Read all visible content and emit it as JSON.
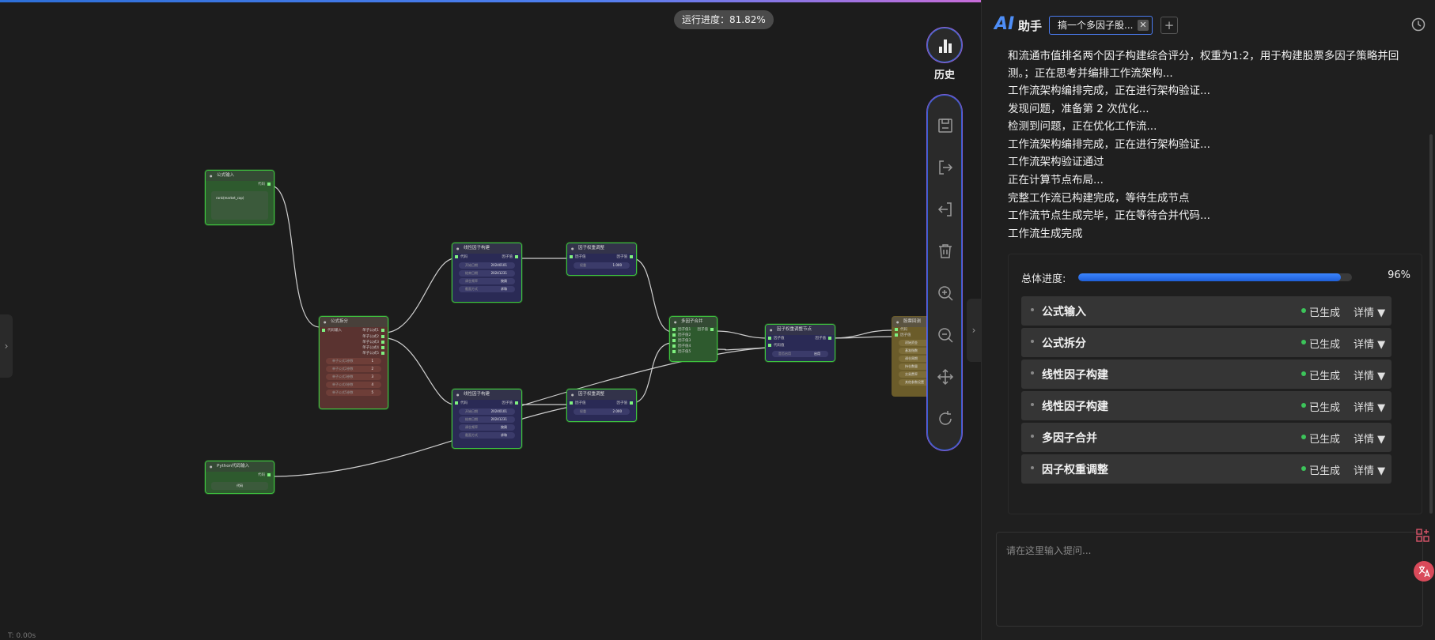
{
  "canvas": {
    "run_progress_text": "运行进度：81.82%",
    "bottom_text": "T: 0.00s",
    "nodes": {
      "formula_input": {
        "title": "公式输入",
        "output": "代码",
        "content": "rank(market_cap)"
      },
      "formula_split": {
        "title": "公式拆分",
        "input": "代码输入",
        "outputs": [
          "单子公式1",
          "单子公式2",
          "单子公式3",
          "单子公式4",
          "单子公式5"
        ],
        "fields": [
          {
            "k": "单子公式1参数",
            "v": "1"
          },
          {
            "k": "单子公式2参数",
            "v": "2"
          },
          {
            "k": "单子公式3参数",
            "v": "3"
          },
          {
            "k": "单子公式4参数",
            "v": "4"
          },
          {
            "k": "单子公式5参数",
            "v": "5"
          }
        ]
      },
      "linear_factor_1": {
        "title": "线性因子构建",
        "input": "代码",
        "output": "因子值",
        "fields": [
          {
            "k": "开始日期",
            "v": "20240101"
          },
          {
            "k": "结束日期",
            "v": "20241231"
          },
          {
            "k": "调仓频率",
            "v": "按周"
          },
          {
            "k": "截面方式",
            "v": "求和"
          }
        ]
      },
      "linear_factor_2": {
        "title": "线性因子构建",
        "input": "代码",
        "output": "因子值",
        "fields": [
          {
            "k": "开始日期",
            "v": "20240101"
          },
          {
            "k": "结束日期",
            "v": "20241231"
          },
          {
            "k": "调仓频率",
            "v": "按周"
          },
          {
            "k": "截面方式",
            "v": "求和"
          }
        ]
      },
      "weight_adjust_1": {
        "title": "因子权重调整",
        "input": "因子值",
        "output": "因子值",
        "fields": [
          {
            "k": "权重",
            "v": "1.000"
          }
        ]
      },
      "weight_adjust_2": {
        "title": "因子权重调整",
        "input": "因子值",
        "output": "因子值",
        "fields": [
          {
            "k": "权重",
            "v": "2.000"
          }
        ]
      },
      "multi_merge": {
        "title": "多因子合并",
        "inputs": [
          "因子值1",
          "因子值2",
          "因子值3",
          "因子值4",
          "因子值5"
        ],
        "output": "因子值"
      },
      "factor_weight_node": {
        "title": "因子权重调整节点",
        "inputs": [
          "因子值",
          "代码值"
        ],
        "output": "因子值",
        "fields": [
          {
            "k": "是否启用",
            "v": "启用"
          }
        ]
      },
      "python_input": {
        "title": "Python代码输入",
        "output": "代码",
        "button": "代码"
      },
      "backtest": {
        "title": "股票回测",
        "inputs": [
          "代码",
          "因子值"
        ],
        "fields": [
          "初始资金",
          "基准指数",
          "调仓周期",
          "持仓数量",
          "交易费率",
          "其他参数设置"
        ]
      }
    }
  },
  "toolbar": {
    "history_label": "历史",
    "tools": [
      "save-icon",
      "export-icon",
      "import-icon",
      "delete-icon",
      "zoom-in-icon",
      "zoom-out-icon",
      "fit-view-icon",
      "refresh-icon"
    ]
  },
  "panel": {
    "logo": "AI",
    "title": "助手",
    "tab_label": "搞一个多因子股...",
    "tab_close": "✕",
    "tab_add": "+",
    "log_lines": [
      "和流通市值排名两个因子构建综合评分，权重为1:2，用于构建股票多因子策略并回测。；正在思考并编排工作流架构...",
      "工作流架构编排完成，正在进行架构验证...",
      "发现问题，准备第 2 次优化...",
      "检测到问题，正在优化工作流...",
      "工作流架构编排完成，正在进行架构验证...",
      "工作流架构验证通过",
      "正在计算节点布局...",
      "完整工作流已构建完成，等待生成节点",
      "工作流节点生成完毕，正在等待合并代码...",
      "工作流生成完成"
    ],
    "progress": {
      "label": "总体进度:",
      "value": 0.96,
      "pct_text": "96%"
    },
    "steps": [
      {
        "name": "公式输入",
        "status": "已生成",
        "detail": "详情 ▼"
      },
      {
        "name": "公式拆分",
        "status": "已生成",
        "detail": "详情 ▼"
      },
      {
        "name": "线性因子构建",
        "status": "已生成",
        "detail": "详情 ▼"
      },
      {
        "name": "线性因子构建",
        "status": "已生成",
        "detail": "详情 ▼"
      },
      {
        "name": "多因子合并",
        "status": "已生成",
        "detail": "详情 ▼"
      },
      {
        "name": "因子权重调整",
        "status": "已生成",
        "detail": "详情 ▼"
      }
    ],
    "input_placeholder": "请在这里输入提问...",
    "colors": {
      "accent": "#4e8ef7",
      "status_ok": "#3cc45a",
      "node_border": "#3ec43e"
    }
  }
}
